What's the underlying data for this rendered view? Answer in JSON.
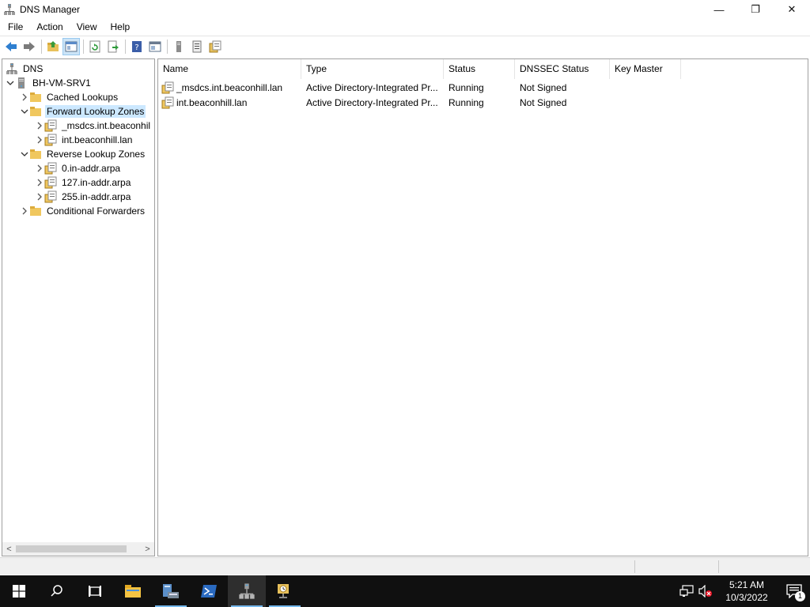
{
  "window": {
    "title": "DNS Manager",
    "controls": {
      "minimize": "—",
      "restore": "❐",
      "close": "✕"
    }
  },
  "menu": [
    "File",
    "Action",
    "View",
    "Help"
  ],
  "toolbar": {
    "buttons": [
      "back-icon",
      "forward-icon",
      "up-folder-icon",
      "show-hide-tree-icon",
      "refresh-icon",
      "export-list-icon",
      "help-icon",
      "properties-icon",
      "server-icon",
      "list-icon",
      "zone-file-icon"
    ]
  },
  "tree": {
    "root": "DNS",
    "server": "BH-VM-SRV1",
    "nodes": [
      {
        "label": "Cached Lookups",
        "type": "folder"
      },
      {
        "label": "Forward Lookup Zones",
        "type": "folder",
        "selected": true
      },
      {
        "label": "_msdcs.int.beaconhil",
        "type": "zone"
      },
      {
        "label": "int.beaconhill.lan",
        "type": "zone"
      },
      {
        "label": "Reverse Lookup Zones",
        "type": "folder"
      },
      {
        "label": "0.in-addr.arpa",
        "type": "zone"
      },
      {
        "label": "127.in-addr.arpa",
        "type": "zone"
      },
      {
        "label": "255.in-addr.arpa",
        "type": "zone"
      },
      {
        "label": "Conditional Forwarders",
        "type": "folder"
      }
    ],
    "scroll": {
      "left": "<",
      "right": ">"
    }
  },
  "list": {
    "columns": [
      "Name",
      "Type",
      "Status",
      "DNSSEC Status",
      "Key Master"
    ],
    "rows": [
      {
        "name": "_msdcs.int.beaconhill.lan",
        "type": "Active Directory-Integrated Pr...",
        "status": "Running",
        "dnssec": "Not Signed",
        "key_master": ""
      },
      {
        "name": "int.beaconhill.lan",
        "type": "Active Directory-Integrated Pr...",
        "status": "Running",
        "dnssec": "Not Signed",
        "key_master": ""
      }
    ]
  },
  "taskbar": {
    "apps": [
      "start-icon",
      "search-icon",
      "task-view-icon",
      "file-explorer-icon",
      "server-manager-icon",
      "powershell-icon",
      "dns-manager-icon",
      "network-diagnostics-icon"
    ],
    "clock": {
      "time": "5:21 AM",
      "date": "10/3/2022"
    },
    "notification_count": "1"
  },
  "colors": {
    "selection": "#cce8ff",
    "taskbar": "#101010",
    "taskbar_indicator": "#76b9ed"
  }
}
